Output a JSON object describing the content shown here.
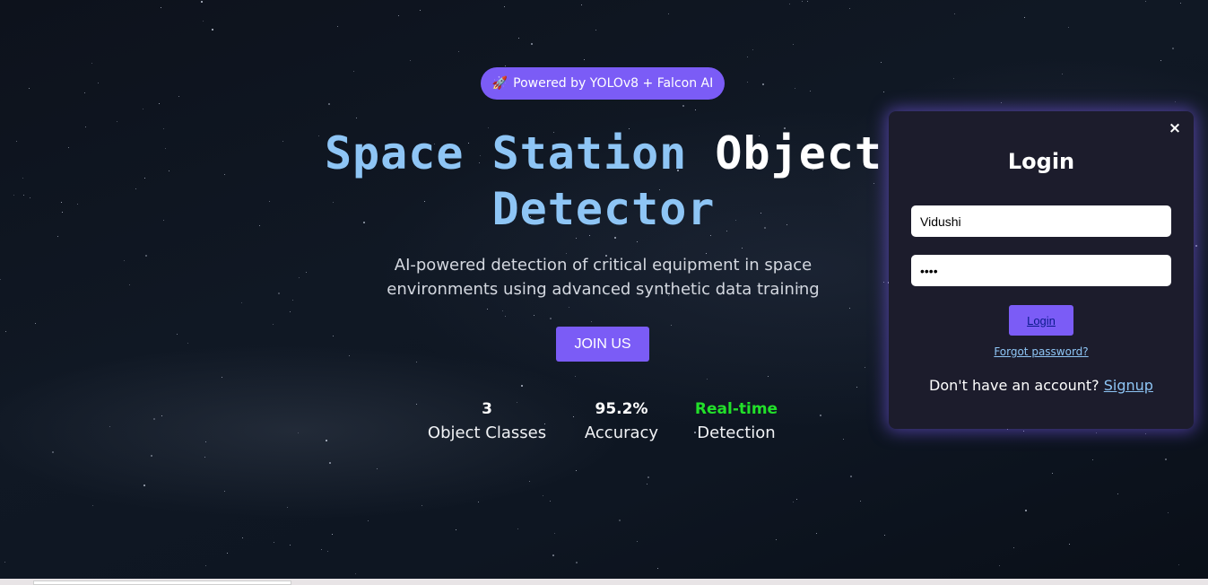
{
  "hero": {
    "badge_icon": "rocket-icon",
    "badge_text": "Powered by YOLOv8 + Falcon AI",
    "title_accent": "Space Station",
    "title_plain": "Object",
    "title_line2": "Detector",
    "subtitle": "AI-powered detection of critical equipment in space environments using advanced synthetic data training",
    "join_label": "JOIN US"
  },
  "stats": [
    {
      "value": "3",
      "label": "Object Classes"
    },
    {
      "value": "95.2%",
      "label": "Accuracy"
    },
    {
      "value": "Real-time",
      "label": "Detection"
    }
  ],
  "login": {
    "close_label": "×",
    "title": "Login",
    "username_value": "Vidushi",
    "password_value": "••••",
    "submit_label": "Login",
    "forgot_label": "Forgot password?",
    "signup_prompt": "Don't have an account?",
    "signup_label": "Signup"
  },
  "colors": {
    "accent": "#7b5cf6",
    "title_accent": "#8ec5f5",
    "realtime_green": "#22e02a",
    "modal_bg": "#1c1c2c"
  }
}
